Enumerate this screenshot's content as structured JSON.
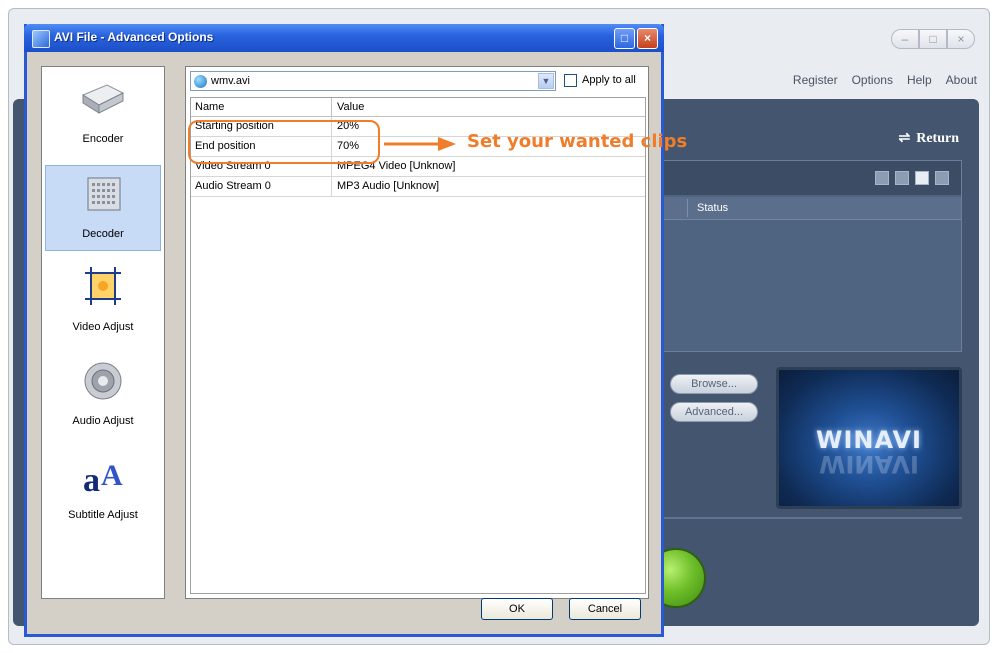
{
  "main_app": {
    "menu": [
      "Register",
      "Options",
      "Help",
      "About"
    ],
    "window_buttons": [
      "–",
      "□",
      "×"
    ],
    "return_label": "Return",
    "list_header_status": "Status",
    "browse_button": "Browse...",
    "advanced_button": "Advanced...",
    "logo_text": "WINAVI"
  },
  "dialog": {
    "title": "AVI File - Advanced Options",
    "title_buttons": [
      "_",
      "□",
      "×"
    ],
    "nav": [
      {
        "label": "Encoder",
        "icon": "hard-drive-icon",
        "active": false
      },
      {
        "label": "Decoder",
        "icon": "decoder-chip-icon",
        "active": true
      },
      {
        "label": "Video Adjust",
        "icon": "crop-frame-icon",
        "active": false
      },
      {
        "label": "Audio Adjust",
        "icon": "speaker-icon",
        "active": false
      },
      {
        "label": "Subtitle Adjust",
        "icon": "text-font-icon",
        "active": false
      }
    ],
    "file_select": {
      "value": "wmv.avi"
    },
    "apply_to_all": {
      "label": "Apply to all",
      "checked": false
    },
    "table": {
      "columns": [
        "Name",
        "Value"
      ],
      "rows": [
        {
          "name": "Starting position",
          "value": "20%"
        },
        {
          "name": "End position",
          "value": "70%"
        },
        {
          "name": "Video Stream 0",
          "value": "MPEG4 Video [Unknow]"
        },
        {
          "name": "Audio Stream 0",
          "value": "MP3 Audio [Unknow]"
        }
      ]
    },
    "ok_button": "OK",
    "cancel_button": "Cancel"
  },
  "annotation": {
    "text": "Set your wanted clips",
    "color": "#ef7d2b"
  }
}
